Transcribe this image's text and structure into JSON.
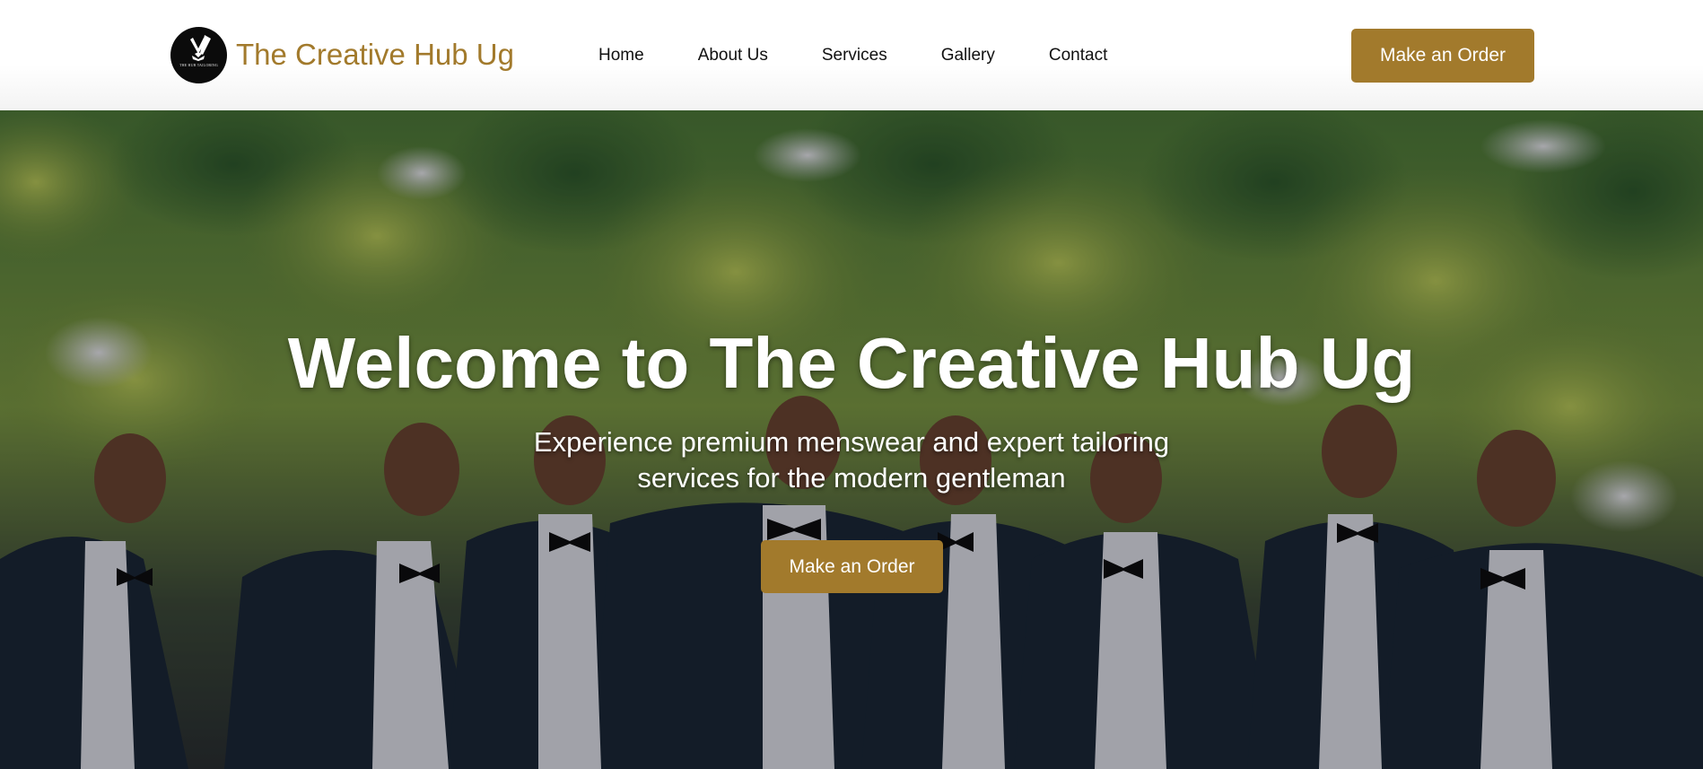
{
  "brand": {
    "name": "The Creative Hub Ug",
    "logo_text": "THE HUB TAILORING",
    "accent_color": "#a27a2c"
  },
  "nav": {
    "links": [
      {
        "label": "Home"
      },
      {
        "label": "About Us"
      },
      {
        "label": "Services"
      },
      {
        "label": "Gallery"
      },
      {
        "label": "Contact"
      }
    ],
    "cta_label": "Make an Order"
  },
  "hero": {
    "title": "Welcome to The Creative Hub Ug",
    "subtitle": "Experience premium menswear and expert tailoring services for the modern gentleman",
    "cta_label": "Make an Order",
    "background_icon": "group-of-men-in-tuxedos-photo"
  }
}
